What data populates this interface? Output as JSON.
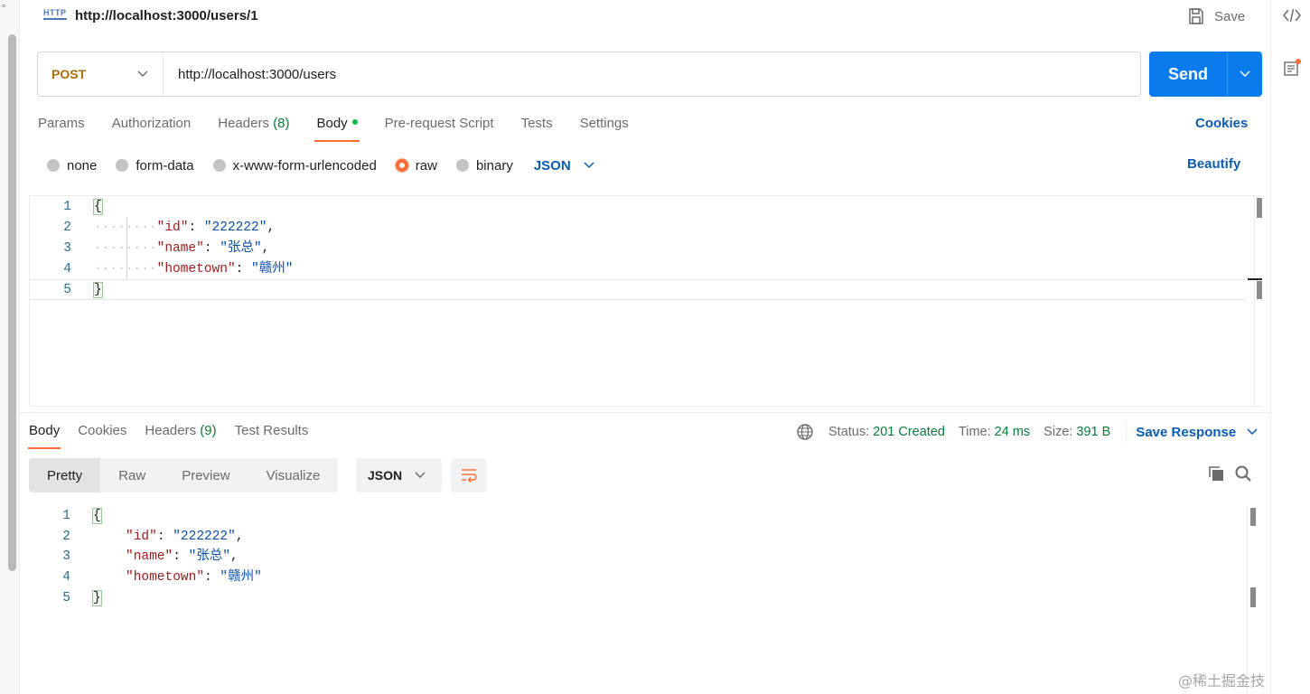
{
  "titlebar": {
    "http_badge": "HTTP",
    "tab_title": "http://localhost:3000/users/1",
    "save_label": "Save"
  },
  "request": {
    "method": "POST",
    "url": "http://localhost:3000/users",
    "send_label": "Send",
    "tabs": [
      {
        "label": "Params",
        "count": ""
      },
      {
        "label": "Authorization",
        "count": ""
      },
      {
        "label": "Headers",
        "count": "(8)"
      },
      {
        "label": "Body",
        "count": ""
      },
      {
        "label": "Pre-request Script",
        "count": ""
      },
      {
        "label": "Tests",
        "count": ""
      },
      {
        "label": "Settings",
        "count": ""
      }
    ],
    "active_tab": "Body",
    "cookies_label": "Cookies",
    "body_types": [
      "none",
      "form-data",
      "x-www-form-urlencoded",
      "raw",
      "binary"
    ],
    "selected_body_type": "raw",
    "format": "JSON",
    "beautify_label": "Beautify",
    "editor_lines": [
      {
        "n": "1",
        "indent": "",
        "key": "",
        "value": "",
        "text": "{",
        "brace": true
      },
      {
        "n": "2",
        "indent": "········",
        "key": "\"id\"",
        "sep": ": ",
        "value": "\"222222\"",
        "tail": ","
      },
      {
        "n": "3",
        "indent": "········",
        "key": "\"name\"",
        "sep": ": ",
        "value": "\"张总\"",
        "tail": ","
      },
      {
        "n": "4",
        "indent": "········",
        "key": "\"hometown\"",
        "sep": ": ",
        "value": "\"赣州\"",
        "tail": ""
      },
      {
        "n": "5",
        "indent": "",
        "key": "",
        "value": "",
        "text": "}",
        "brace": true
      }
    ]
  },
  "response": {
    "tabs": [
      {
        "label": "Body",
        "count": ""
      },
      {
        "label": "Cookies",
        "count": ""
      },
      {
        "label": "Headers",
        "count": "(9)"
      },
      {
        "label": "Test Results",
        "count": ""
      }
    ],
    "status_label": "Status:",
    "status_value": "201 Created",
    "time_label": "Time:",
    "time_value": "24 ms",
    "size_label": "Size:",
    "size_value": "391 B",
    "save_response_label": "Save Response",
    "view_modes": [
      "Pretty",
      "Raw",
      "Preview",
      "Visualize"
    ],
    "active_view": "Pretty",
    "format": "JSON",
    "body_lines": [
      {
        "n": "1",
        "text": "{",
        "brace": true
      },
      {
        "n": "2",
        "key": "\"id\"",
        "sep": ": ",
        "value": "\"222222\"",
        "tail": ","
      },
      {
        "n": "3",
        "key": "\"name\"",
        "sep": ": ",
        "value": "\"张总\"",
        "tail": ","
      },
      {
        "n": "4",
        "key": "\"hometown\"",
        "sep": ": ",
        "value": "\"赣州\"",
        "tail": ""
      },
      {
        "n": "5",
        "text": "}",
        "brace": true
      }
    ]
  },
  "watermark": "@稀土掘金技术社区",
  "colors": {
    "accent_orange": "#ff6c37",
    "send_blue": "#097bed",
    "link_blue": "#0b5cad",
    "method_post": "#a76c02",
    "status_green": "#0a7a3c",
    "json_key": "#9b1b1b",
    "json_string": "#0b4ea8"
  }
}
